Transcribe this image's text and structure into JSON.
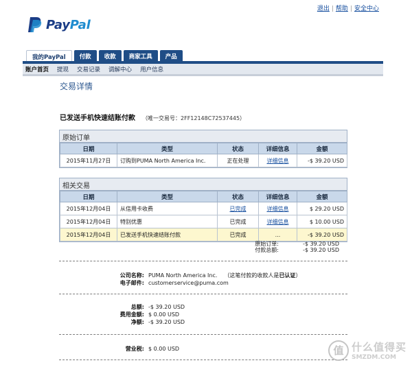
{
  "toplinks": [
    "退出",
    "帮助",
    "安全中心"
  ],
  "brand": {
    "pay": "Pay",
    "pal": "Pal",
    "logo_color": "#1b3d86",
    "accent": "#1f8ccf"
  },
  "tabs": [
    "我的PayPal",
    "付款",
    "收款",
    "商家工具",
    "产品"
  ],
  "subnav": [
    "账户首页",
    "提现",
    "交易记录",
    "调解中心",
    "用户信息"
  ],
  "page_title": "交易详情",
  "transaction": {
    "title": "已发送手机快速结账付款",
    "id_label": "（唯一交易号：2FF12148C72537445）"
  },
  "original_order": {
    "heading": "原始订单",
    "columns": [
      "日期",
      "类型",
      "状态",
      "详细信息",
      "金额"
    ],
    "rows": [
      {
        "date": "2015年11月27日",
        "type": "订购到PUMA North America Inc.",
        "status": "正在处理",
        "detail": "详细信息",
        "amount": "-$ 39.20 USD"
      }
    ]
  },
  "related": {
    "heading": "相关交易",
    "columns": [
      "日期",
      "类型",
      "状态",
      "详细信息",
      "金额"
    ],
    "rows": [
      {
        "date": "2015年12月04日",
        "type": "从信用卡收费",
        "status": "已完成",
        "detail": "详细信息",
        "amount": "$ 29.20 USD"
      },
      {
        "date": "2015年12月04日",
        "type": "特别优惠",
        "status": "已完成",
        "detail": "详细信息",
        "amount": "$ 10.00 USD"
      },
      {
        "date": "2015年12月04日",
        "type": "已发送手机快速结账付款",
        "status": "已完成",
        "detail": "...",
        "amount": "-$ 39.20 USD"
      }
    ],
    "summary": [
      {
        "label": "原始订单:",
        "value": "-$ 39.20 USD"
      },
      {
        "label": "付款总额:",
        "value": "-$ 39.20 USD"
      }
    ]
  },
  "merchant": {
    "company_label": "公司名称:",
    "company_value": "PUMA North America Inc.",
    "verified_note": "（这笔付款的收款人是",
    "verified_status": "已认证",
    "verified_close": "）",
    "email_label": "电子邮件:",
    "email_value": "customerservice@puma.com"
  },
  "totals": [
    {
      "label": "总额:",
      "value": "-$ 39.20 USD"
    },
    {
      "label": "费用金额:",
      "value": "$ 0.00 USD"
    },
    {
      "label": "净额:",
      "value": "-$ 39.20 USD"
    }
  ],
  "tax": {
    "label": "营业税:",
    "value": "$ 0.00 USD"
  },
  "watermark": {
    "symbol": "值",
    "cn": "什么值得买",
    "en": "SMZDM.COM"
  }
}
